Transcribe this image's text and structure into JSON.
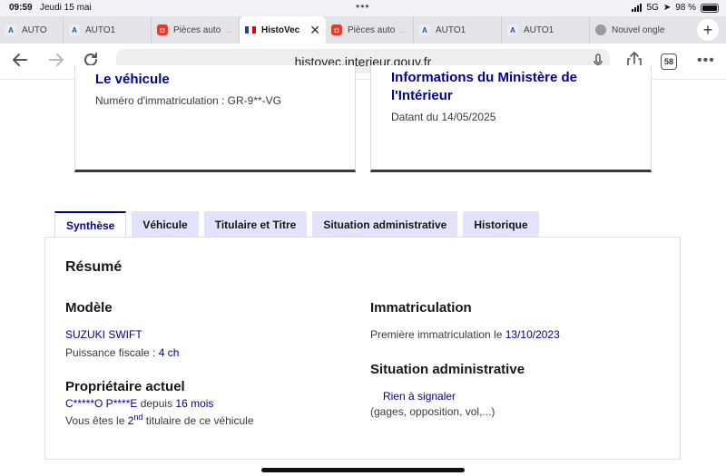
{
  "status": {
    "time": "09:59",
    "date": "Jeudi 15 mai",
    "network": "5G",
    "battery": "98 %"
  },
  "tabs": [
    {
      "label": "AUTO",
      "icon": "auto1-logo-icon"
    },
    {
      "label": "AUTO1",
      "icon": "auto1-logo-icon"
    },
    {
      "label": "Pièces auto",
      "icon": "pieces-auto-logo-icon"
    },
    {
      "label": "HistoVec",
      "icon": "french-flag-icon",
      "active": true
    },
    {
      "label": "Pièces auto",
      "icon": "pieces-auto-logo-icon"
    },
    {
      "label": "AUTO1",
      "icon": "auto1-logo-icon"
    },
    {
      "label": "AUTO1",
      "icon": "auto1-logo-icon"
    },
    {
      "label": "Nouvel ongle",
      "icon": "globe-icon"
    }
  ],
  "toolbar": {
    "url": "histovec.interieur.gouv.fr",
    "tab_count": "58"
  },
  "cards": {
    "vehicle": {
      "title": "Le véhicule",
      "text": "Numéro d'immatriculation : GR-9**-VG"
    },
    "ministry": {
      "title_line1": "Informations du Ministère de",
      "title_line2": "l'Intérieur",
      "text": "Datant du 14/05/2025"
    }
  },
  "page_tabs": [
    "Synthèse",
    "Véhicule",
    "Titulaire et Titre",
    "Situation administrative",
    "Historique"
  ],
  "summary": {
    "heading": "Résumé",
    "model": {
      "heading": "Modèle",
      "name": "SUZUKI SWIFT",
      "power_label": "Puissance fiscale : ",
      "power_value": "4 ch"
    },
    "owner": {
      "heading": "Propriétaire actuel",
      "name": "C*****O P****E",
      "since_label": " depuis ",
      "since_value": "16 mois",
      "rank_prefix": "Vous êtes le ",
      "rank_num": "2",
      "rank_sup": "nd",
      "rank_suffix": " titulaire de ce véhicule"
    },
    "registration": {
      "heading": "Immatriculation",
      "first_label": "Première immatriculation le ",
      "first_date": "13/10/2023"
    },
    "admin": {
      "heading": "Situation administrative",
      "status": "Rien à signaler",
      "details": "(gages, opposition, vol,...)"
    }
  }
}
